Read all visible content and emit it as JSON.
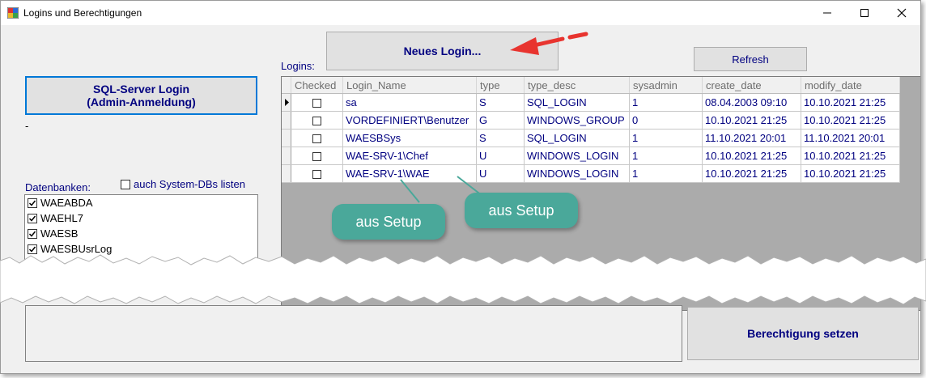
{
  "window": {
    "title": "Logins und Berechtigungen",
    "controls": {
      "minimize": "—",
      "maximize": "☐",
      "close": "✕"
    }
  },
  "left": {
    "sql_login_button": {
      "line1": "SQL-Server Login",
      "line2": "(Admin-Anmeldung)"
    },
    "status_text": "-",
    "databases_label": "Datenbanken:",
    "system_dbs_label": "auch System-DBs listen",
    "system_dbs_checked": false,
    "databases": [
      {
        "name": "WAEABDA",
        "checked": true
      },
      {
        "name": "WAEHL7",
        "checked": true
      },
      {
        "name": "WAESB",
        "checked": true
      },
      {
        "name": "WAESBUsrLog",
        "checked": true
      }
    ]
  },
  "top": {
    "new_login_button": "Neues Login...",
    "refresh_button": "Refresh",
    "logins_label": "Logins:"
  },
  "grid": {
    "columns": [
      "Checked",
      "Login_Name",
      "type",
      "type_desc",
      "sysadmin",
      "create_date",
      "modify_date"
    ],
    "rows": [
      {
        "login_name": "sa",
        "type": "S",
        "type_desc": "SQL_LOGIN",
        "sysadmin": "1",
        "create_date": "08.04.2003 09:10",
        "modify_date": "10.10.2021 21:25"
      },
      {
        "login_name": "VORDEFINIERT\\Benutzer",
        "type": "G",
        "type_desc": "WINDOWS_GROUP",
        "sysadmin": "0",
        "create_date": "10.10.2021 21:25",
        "modify_date": "10.10.2021 21:25"
      },
      {
        "login_name": "WAESBSys",
        "type": "S",
        "type_desc": "SQL_LOGIN",
        "sysadmin": "1",
        "create_date": "11.10.2021 20:01",
        "modify_date": "11.10.2021 20:01"
      },
      {
        "login_name": "WAE-SRV-1\\Chef",
        "type": "U",
        "type_desc": "WINDOWS_LOGIN",
        "sysadmin": "1",
        "create_date": "10.10.2021 21:25",
        "modify_date": "10.10.2021 21:25"
      },
      {
        "login_name": "WAE-SRV-1\\WAE",
        "type": "U",
        "type_desc": "WINDOWS_LOGIN",
        "sysadmin": "1",
        "create_date": "10.10.2021 21:25",
        "modify_date": "10.10.2021 21:25"
      }
    ]
  },
  "annotations": {
    "callout_1": "aus Setup",
    "callout_2": "aus Setup"
  },
  "bottom": {
    "set_permission_button": "Berechtigung setzen"
  },
  "colors": {
    "accent_text": "#000080",
    "callout": "#4aa89a",
    "arrow": "#e8342f",
    "focus_border": "#0078d7"
  }
}
